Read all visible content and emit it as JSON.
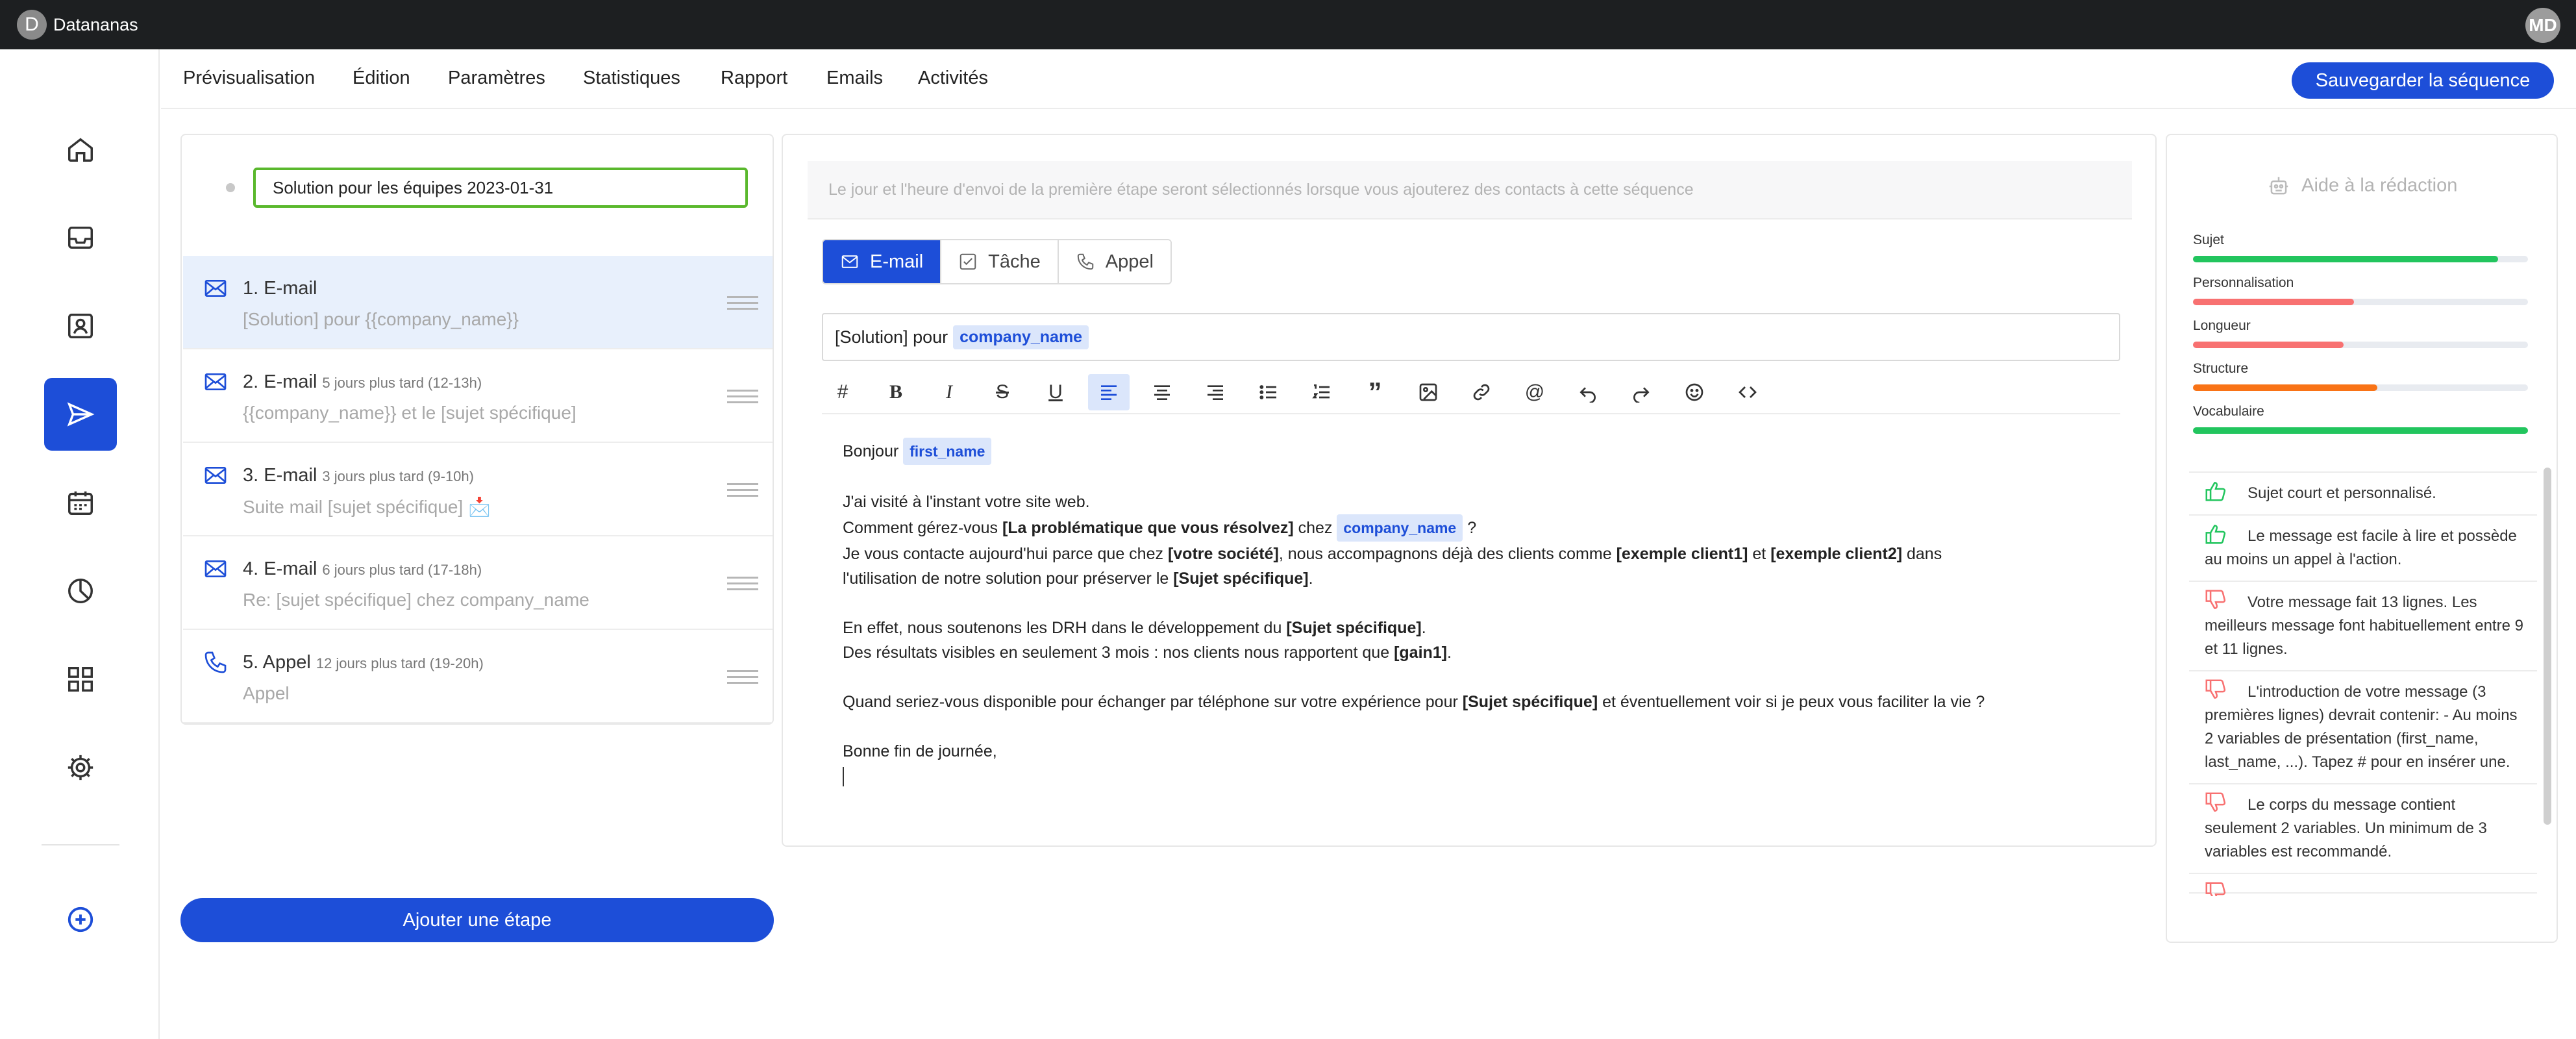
{
  "app": {
    "name": "Datananas",
    "logo_letter": "D",
    "user_initials": "MD"
  },
  "colors": {
    "primary": "#1d4ed8",
    "success": "#22c55e",
    "danger": "#f87171",
    "warning": "#f97316"
  },
  "sidebar": {
    "items": [
      {
        "icon": "home-icon",
        "active": false
      },
      {
        "icon": "inbox-icon",
        "active": false
      },
      {
        "icon": "contacts-icon",
        "active": false
      },
      {
        "icon": "send-icon",
        "active": true
      },
      {
        "icon": "calendar-icon",
        "active": false
      },
      {
        "icon": "pie-chart-icon",
        "active": false
      },
      {
        "icon": "grid-icon",
        "active": false
      },
      {
        "icon": "gear-icon",
        "active": false
      },
      {
        "icon": "plus-circle-icon",
        "active": false
      }
    ]
  },
  "topnav": {
    "tabs": [
      "Prévisualisation",
      "Édition",
      "Paramètres",
      "Statistiques",
      "Rapport",
      "Emails",
      "Activités"
    ],
    "save_label": "Sauvegarder la séquence"
  },
  "steps_panel": {
    "sequence_name": "Solution pour les équipes 2023-01-31",
    "steps": [
      {
        "title": "1. E-mail",
        "delay": "",
        "subtitle": "[Solution] pour {{company_name}}",
        "icon": "mail-icon",
        "active": true
      },
      {
        "title": "2. E-mail",
        "delay": "5 jours plus tard (12-13h)",
        "subtitle": "{{company_name}} et le [sujet spécifique]",
        "icon": "mail-icon",
        "active": false
      },
      {
        "title": "3. E-mail",
        "delay": "3 jours plus tard (9-10h)",
        "subtitle": "Suite mail [sujet spécifique] 📩",
        "icon": "mail-icon",
        "active": false
      },
      {
        "title": "4. E-mail",
        "delay": "6 jours plus tard (17-18h)",
        "subtitle": "Re: [sujet spécifique] chez company_name",
        "icon": "mail-icon",
        "active": false
      },
      {
        "title": "5. Appel",
        "delay": "12 jours plus tard (19-20h)",
        "subtitle": "Appel",
        "icon": "phone-icon",
        "active": false
      }
    ],
    "add_step_label": "Ajouter une étape"
  },
  "editor": {
    "info_banner": "Le jour et l'heure d'envoi de la première étape seront sélectionnés lorsque vous ajouterez des contacts à cette séquence",
    "type_tabs": [
      {
        "label": "E-mail",
        "icon": "mail-icon",
        "active": true
      },
      {
        "label": "Tâche",
        "icon": "task-icon",
        "active": false
      },
      {
        "label": "Appel",
        "icon": "phone-icon",
        "active": false
      }
    ],
    "subject_text": "[Solution] pour",
    "subject_var": "company_name",
    "toolbar_icons": [
      "hash-icon",
      "bold-icon",
      "italic-icon",
      "strikethrough-icon",
      "underline-icon",
      "align-left-icon",
      "align-center-icon",
      "align-right-icon",
      "bullet-list-icon",
      "numbered-list-icon",
      "quote-icon",
      "image-icon",
      "link-icon",
      "mention-icon",
      "undo-icon",
      "redo-icon",
      "emoji-icon",
      "code-icon"
    ],
    "body": {
      "greeting": "Bonjour",
      "greeting_var": "first_name",
      "l2": "J'ai visité à l'instant votre site web.",
      "l3a": "Comment gérez-vous",
      "l3b": "[La problématique que vous résolvez]",
      "l3c": "chez",
      "l3var": "company_name",
      "l3d": "?",
      "l4a": "Je vous contacte aujourd'hui parce que chez",
      "l4b": "[votre société]",
      "l4c": ", nous accompagnons déjà des clients comme",
      "l4d": "[exemple client1]",
      "l4e": "et",
      "l4f": "[exemple client2]",
      "l4g": "dans",
      "l5a": "l'utilisation de notre solution pour préserver le",
      "l5b": "[Sujet spécifique]",
      "l5c": ".",
      "l6a": "En effet, nous soutenons les DRH dans le développement du",
      "l6b": "[Sujet spécifique]",
      "l6c": ".",
      "l7a": "Des résultats visibles en seulement 3 mois : nos clients nous rapportent que",
      "l7b": "[gain1]",
      "l7c": ".",
      "l8a": "Quand seriez-vous disponible pour échanger par téléphone sur votre expérience pour",
      "l8b": "[Sujet spécifique]",
      "l8c": "et éventuellement voir si je peux vous faciliter la vie ?",
      "l9": "Bonne fin de journée,"
    }
  },
  "help_panel": {
    "title": "Aide à la rédaction",
    "metrics": [
      {
        "label": "Sujet",
        "level": 0.91,
        "color": "#22c55e"
      },
      {
        "label": "Personnalisation",
        "level": 0.48,
        "color": "#f87171"
      },
      {
        "label": "Longueur",
        "level": 0.45,
        "color": "#f87171"
      },
      {
        "label": "Structure",
        "level": 0.55,
        "color": "#f97316"
      },
      {
        "label": "Vocabulaire",
        "level": 1.0,
        "color": "#22c55e"
      }
    ],
    "feedback": [
      {
        "type": "positive",
        "text": "Sujet court et personnalisé."
      },
      {
        "type": "positive",
        "text": "Le message est facile à lire et possède au moins un appel à l'action."
      },
      {
        "type": "negative",
        "text": "Votre message fait 13 lignes. Les meilleurs message font habituellement entre 9 et 11 lignes."
      },
      {
        "type": "negative",
        "text": "L'introduction de votre message (3 premières lignes) devrait contenir: - Au moins 2 variables de présentation (first_name, last_name, ...). Tapez # pour en insérer une."
      },
      {
        "type": "negative",
        "text": "Le corps du message contient seulement 2 variables. Un minimum de 3 variables est recommandé."
      },
      {
        "type": "negative",
        "text": ""
      }
    ]
  }
}
